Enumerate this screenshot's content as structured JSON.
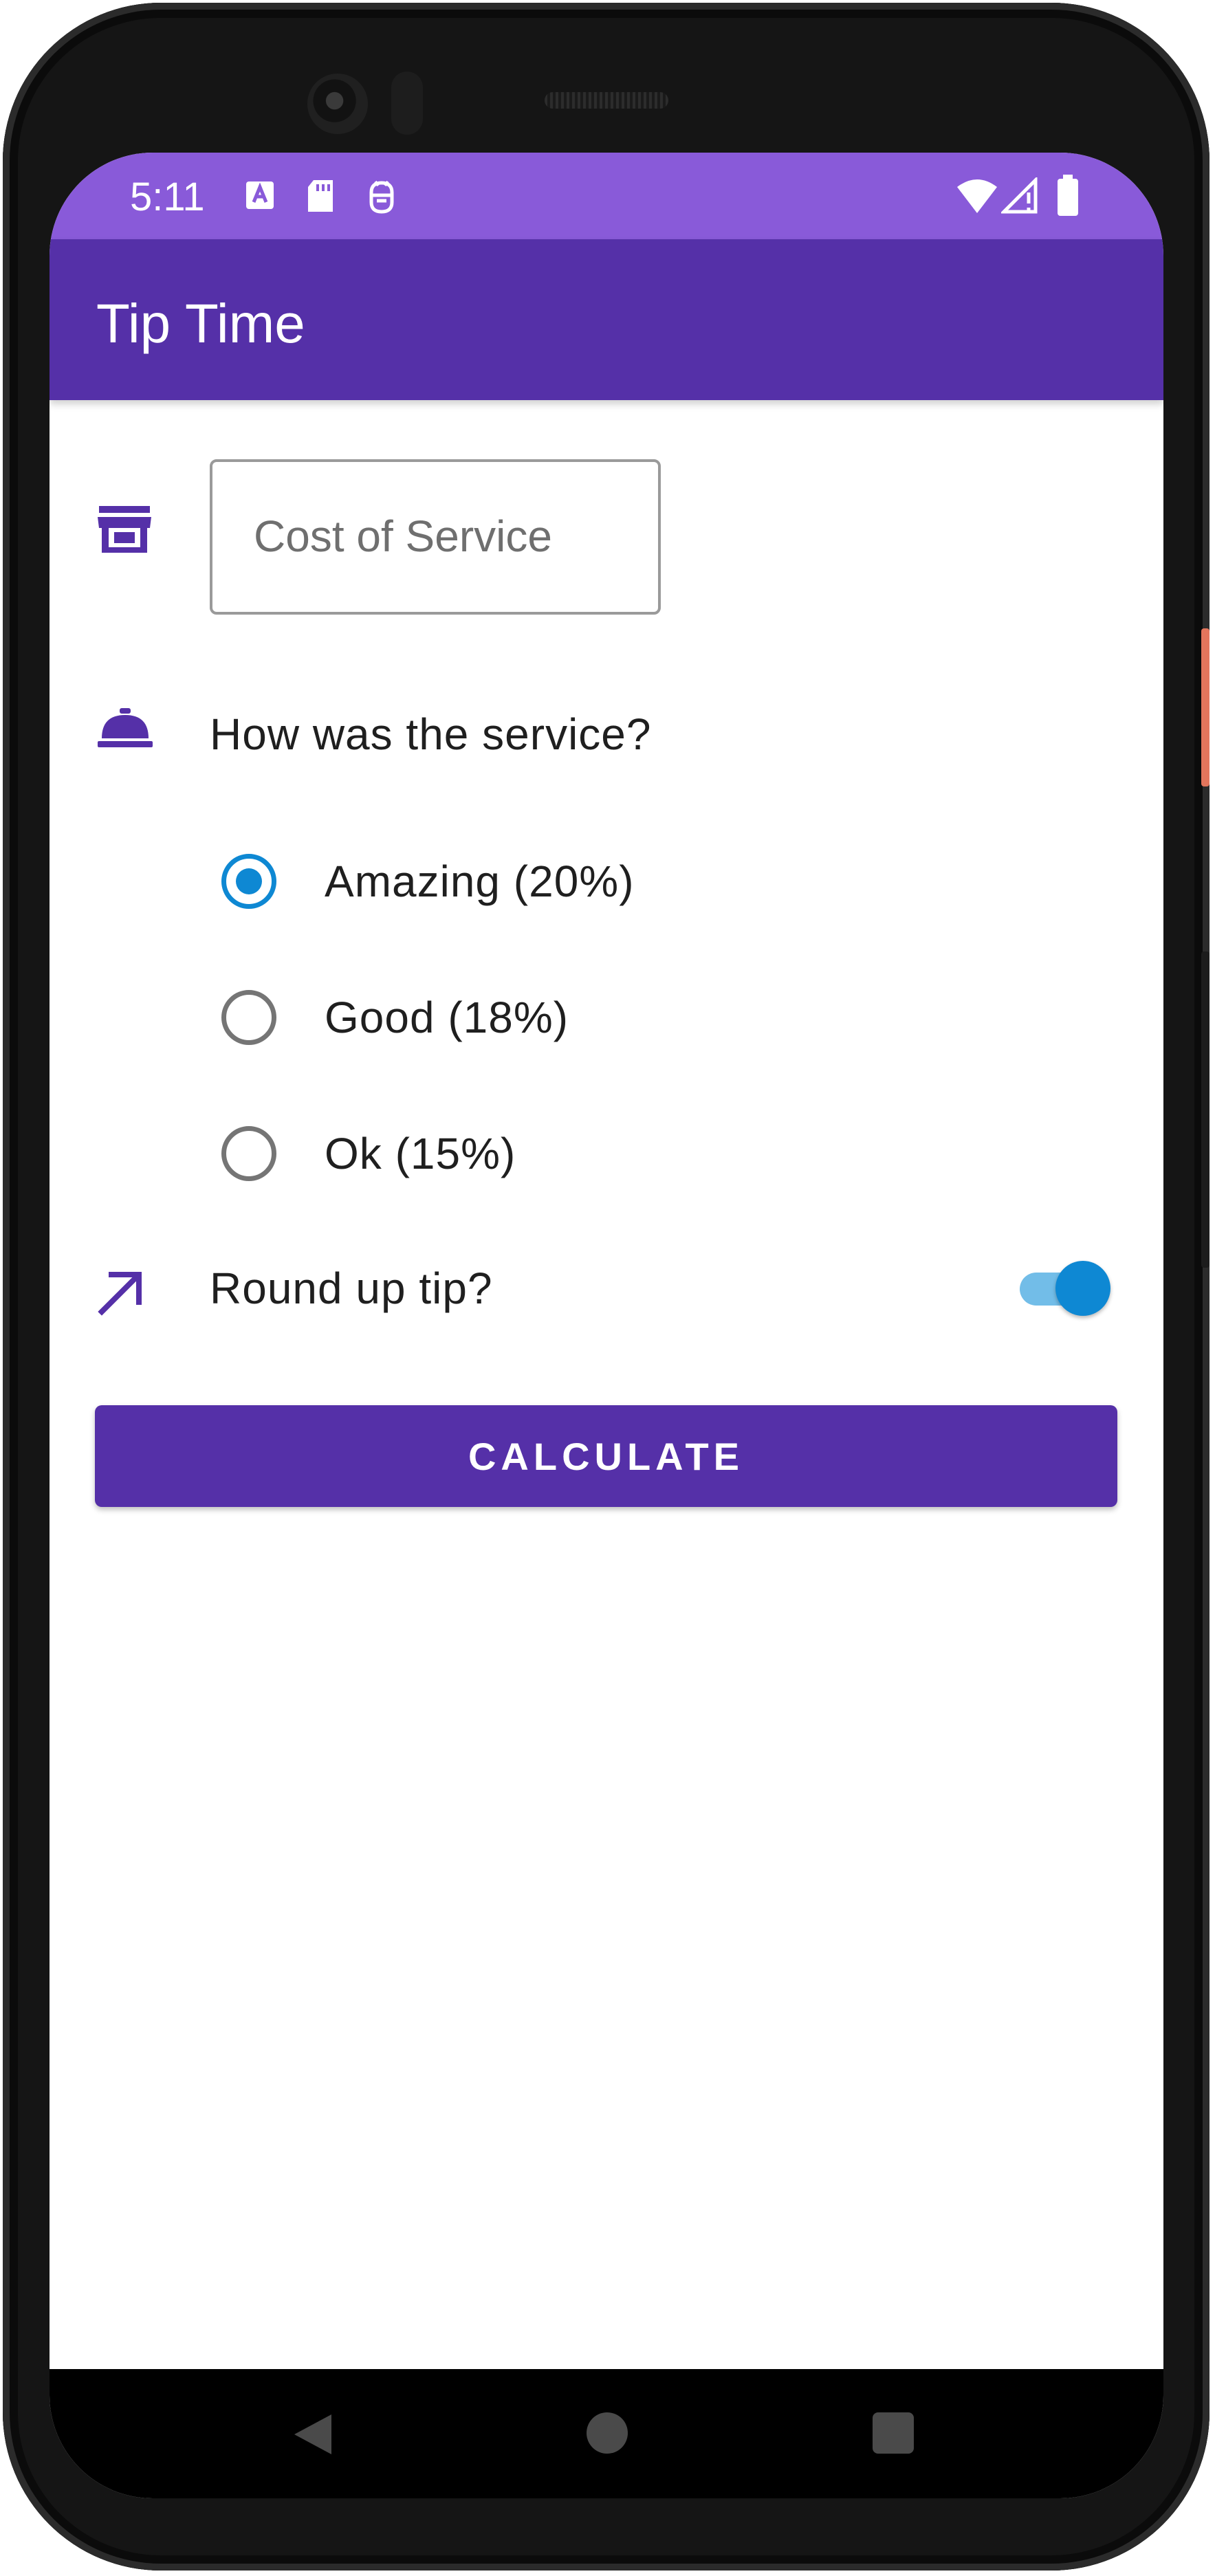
{
  "status_bar": {
    "time": "5:11",
    "icons": [
      "a-notification-icon",
      "sd-card-icon",
      "debug-icon",
      "wifi-icon",
      "signal-icon",
      "battery-icon"
    ]
  },
  "app_bar": {
    "title": "Tip Time"
  },
  "cost_input": {
    "placeholder": "Cost of Service",
    "value": ""
  },
  "service_question": {
    "label": "How was the service?"
  },
  "tip_options": [
    {
      "label": "Amazing (20%)",
      "checked": true
    },
    {
      "label": "Good (18%)",
      "checked": false
    },
    {
      "label": "Ok (15%)",
      "checked": false
    }
  ],
  "round_up": {
    "label": "Round up tip?",
    "enabled": true
  },
  "calculate_button": {
    "label": "CALCULATE"
  },
  "colors": {
    "primary": "#5530a8",
    "status_bar": "#895ad9",
    "accent": "#0e88d3",
    "switch_track": "#72bde8"
  },
  "nav_bar": {
    "buttons": [
      "back-icon",
      "home-icon",
      "recents-icon"
    ]
  }
}
